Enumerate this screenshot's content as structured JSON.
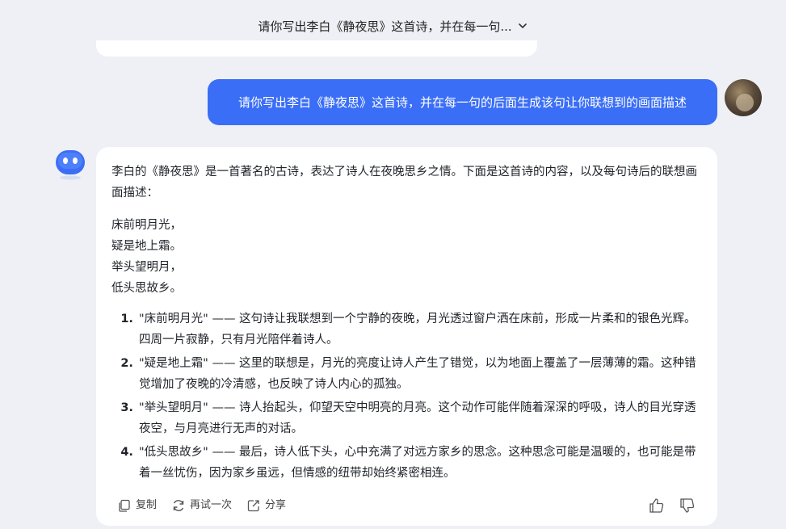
{
  "header": {
    "title": "请你写出李白《静夜思》这首诗，并在每一句..."
  },
  "user_message": {
    "text": "请你写出李白《静夜思》这首诗，并在每一句的后面生成该句让你联想到的画面描述"
  },
  "bot_message": {
    "intro": "李白的《静夜思》是一首著名的古诗，表达了诗人在夜晚思乡之情。下面是这首诗的内容，以及每句诗后的联想画面描述：",
    "poem": [
      "床前明月光，",
      "疑是地上霜。",
      "举头望明月，",
      "低头思故乡。"
    ],
    "items": [
      "\"床前明月光\" —— 这句诗让我联想到一个宁静的夜晚，月光透过窗户洒在床前，形成一片柔和的银色光辉。四周一片寂静，只有月光陪伴着诗人。",
      "\"疑是地上霜\" —— 这里的联想是，月光的亮度让诗人产生了错觉，以为地面上覆盖了一层薄薄的霜。这种错觉增加了夜晚的冷清感，也反映了诗人内心的孤独。",
      "\"举头望明月\" —— 诗人抬起头，仰望天空中明亮的月亮。这个动作可能伴随着深深的呼吸，诗人的目光穿透夜空，与月亮进行无声的对话。",
      "\"低头思故乡\" —— 最后，诗人低下头，心中充满了对远方家乡的思念。这种思念可能是温暖的，也可能是带着一丝忧伤，因为家乡虽远，但情感的纽带却始终紧密相连。"
    ]
  },
  "actions": {
    "copy": "复制",
    "retry": "再试一次",
    "share": "分享"
  },
  "colors": {
    "accent": "#3a6ef6",
    "background": "#eef0f5",
    "card": "#ffffff"
  }
}
